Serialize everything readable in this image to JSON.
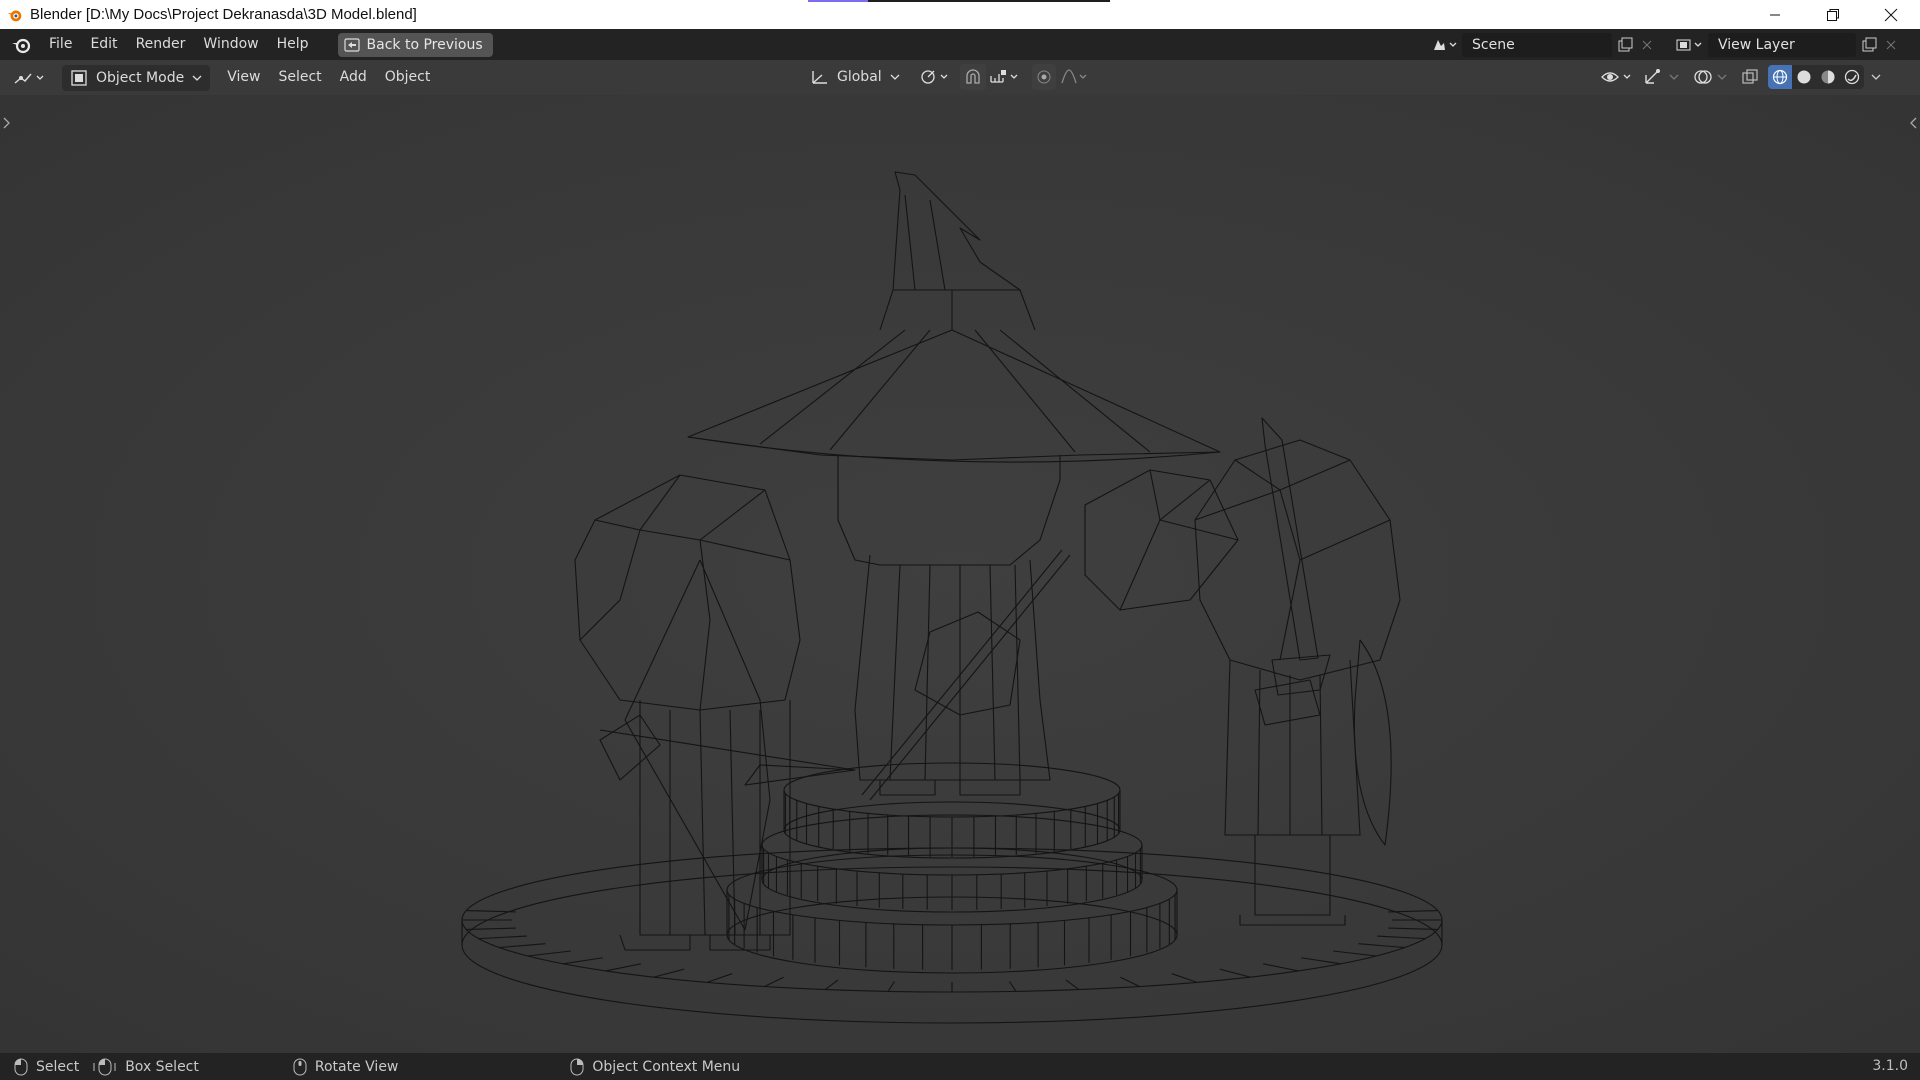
{
  "window": {
    "title": "Blender [D:\\My Docs\\Project Dekranasda\\3D Model.blend]",
    "controls": [
      "minimize-icon",
      "restore-icon",
      "close-icon"
    ]
  },
  "menu": {
    "items": [
      "File",
      "Edit",
      "Render",
      "Window",
      "Help"
    ],
    "back_button": "Back to Previous",
    "scene_label": "Scene",
    "view_layer_label": "View Layer"
  },
  "viewport_header": {
    "mode": "Object Mode",
    "menus": [
      "View",
      "Select",
      "Add",
      "Object"
    ],
    "transform_orientation": "Global",
    "shading_active": "wireframe"
  },
  "statusbar": {
    "items": [
      {
        "icon": "mouse-left-icon",
        "label": "Select"
      },
      {
        "icon": "mouse-drag-icon",
        "label": "Box Select"
      },
      {
        "icon": "mouse-middle-icon",
        "label": "Rotate View"
      },
      {
        "icon": "mouse-right-icon",
        "label": "Object Context Menu"
      }
    ],
    "version": "3.1.0"
  },
  "colors": {
    "accent": "#4772b3",
    "header_bg": "#232323",
    "viewport_bg": "#3a3a3a",
    "wire": "#111111"
  }
}
